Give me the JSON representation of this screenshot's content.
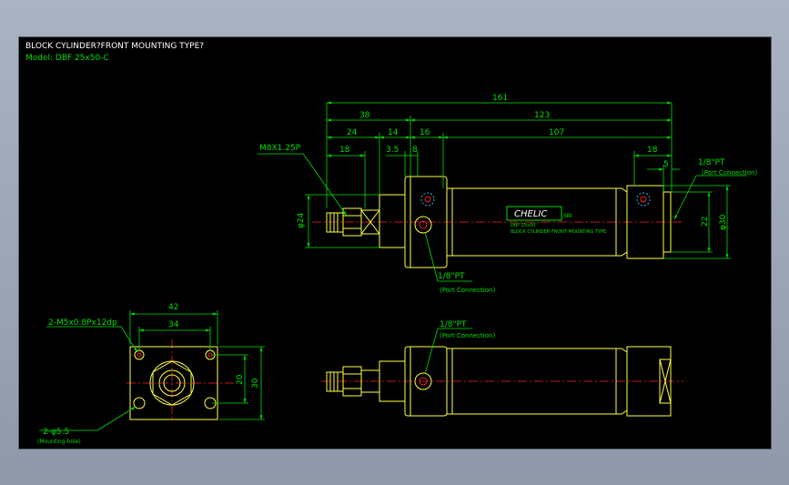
{
  "header": {
    "title": "BLOCK CYLINDER?FRONT MOUNTING TYPE?",
    "model": "Model:  DBF  25x50-C"
  },
  "colors": {
    "dimension": "#00e000",
    "part": "#ffff40",
    "center": "#ff2020",
    "white": "#ffffff",
    "cyan": "#20c0ff"
  },
  "side_view": {
    "dims": {
      "d161": "161",
      "d38": "38",
      "d123": "123",
      "d24": "24",
      "d14": "14",
      "d16": "16",
      "d107": "107",
      "d18a": "18",
      "d3_5": "3.5",
      "d8": "8",
      "d18b": "18",
      "d5": "5",
      "d24v": "φ24",
      "d22": "22",
      "d30": "φ30"
    },
    "thread_label": "M8X1.25P",
    "port_right": "1/8\"PT",
    "port_right_sub": "(Port Connection)",
    "port_bottom": "1/8\"PT",
    "port_bottom_sub": "(Port Connection)",
    "brand": "CHELIC",
    "brand_badge": "SBI",
    "brand_line1": "DBF 25x50",
    "brand_line2": "BLOCK CYLINDER FRONT MOUNTING TYPE"
  },
  "end_view": {
    "d42": "42",
    "d34": "34",
    "d20": "20",
    "d30": "30",
    "holes_label": "2-M5x0.8Px12dp",
    "mount_label": "2-φ5.5",
    "mount_sub": "(Mounting-hole)"
  },
  "bottom_view": {
    "port": "1/8\"PT",
    "port_sub": "(Port Connection)"
  }
}
